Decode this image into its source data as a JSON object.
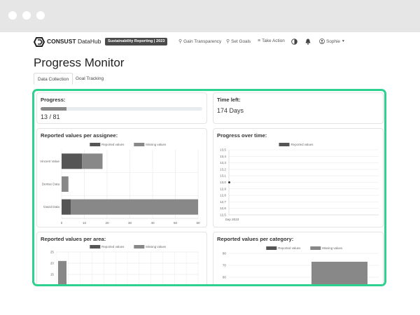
{
  "browser": {
    "dots": [
      "window-dot",
      "window-dot",
      "window-dot"
    ]
  },
  "nav": {
    "brand": "CONSUST",
    "brand_suffix": "DataHub",
    "badge": "Sustainability Reporting | 2023",
    "items": [
      {
        "label": "Gain Transparency",
        "icon": "search-icon"
      },
      {
        "label": "Set Goals",
        "icon": "trophy-icon"
      },
      {
        "label": "Take Action",
        "icon": "list-icon"
      }
    ],
    "user": "Sophie"
  },
  "page": {
    "title": "Progress Monitor"
  },
  "tabs": [
    {
      "label": "Data Collection",
      "active": true
    },
    {
      "label": "Goal Tracking",
      "active": false
    }
  ],
  "cards": {
    "progress": {
      "title": "Progress:",
      "value": "13 / 81",
      "fraction": 0.16
    },
    "time_left": {
      "title": "Time left:",
      "value": "174 Days"
    },
    "per_assignee": {
      "title": "Reported values per assignee:"
    },
    "over_time": {
      "title": "Progress over time:"
    },
    "per_area": {
      "title": "Reported values per area:"
    },
    "per_category": {
      "title": "Reported values per category:"
    }
  },
  "colors": {
    "highlight": "#2ed18d",
    "reported": "#555555",
    "missing": "#888888"
  },
  "chart_data": [
    {
      "type": "bar",
      "orientation": "horizontal",
      "stacked": true,
      "categories": [
        "Vincent Value",
        "Denise Data",
        "David Data"
      ],
      "series": [
        {
          "name": "Reported values",
          "values": [
            9,
            0,
            4
          ]
        },
        {
          "name": "Missing values",
          "values": [
            9,
            3,
            56
          ]
        }
      ],
      "xlim": [
        0,
        60
      ],
      "xticks": [
        "0",
        "10",
        "20",
        "30",
        "40",
        "50",
        "60"
      ],
      "legend": "top",
      "grid": true
    },
    {
      "type": "line",
      "x": [
        "Sep 2023"
      ],
      "series": [
        {
          "name": "Reported values",
          "values": [
            13
          ]
        }
      ],
      "ylim": [
        12.5,
        13.5
      ],
      "yticks": [
        "13,5",
        "13,4",
        "13,3",
        "13,2",
        "13,1",
        "13,0",
        "12,9",
        "12,8",
        "12,7",
        "12,6",
        "12,5"
      ],
      "xticks": [
        "Sep 2023"
      ],
      "legend": "top",
      "grid": true
    },
    {
      "type": "bar",
      "stacked": true,
      "series": [
        {
          "name": "Reported values",
          "values": []
        },
        {
          "name": "Missing values",
          "values": [
            21
          ]
        }
      ],
      "yticks": [
        "25",
        "20",
        "15"
      ],
      "legend": "top",
      "grid": true
    },
    {
      "type": "bar",
      "stacked": true,
      "series": [
        {
          "name": "Reported values",
          "values": []
        },
        {
          "name": "Missing values",
          "values": [
            73
          ]
        }
      ],
      "yticks": [
        "80",
        "70",
        "60",
        "50"
      ],
      "legend": "top",
      "grid": true
    }
  ]
}
